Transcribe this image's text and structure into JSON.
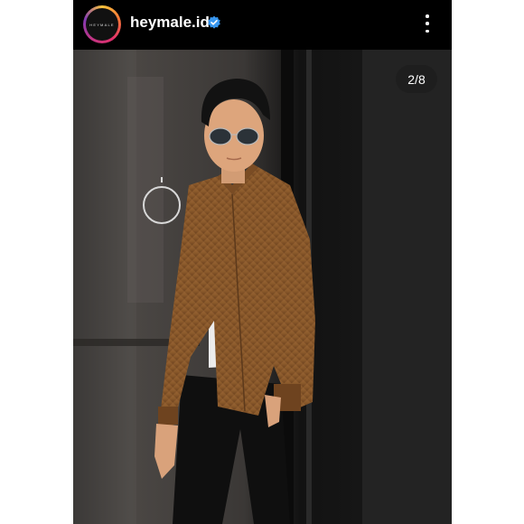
{
  "post": {
    "username": "heymale.id",
    "avatar_text": "HEYMALE",
    "verified_icon": "verified-badge-icon",
    "more_icon": "more-options-icon",
    "carousel_counter": "2/8",
    "colors": {
      "background": "#000000",
      "username": "#ffffff",
      "verified": "#3897f0",
      "jacket": "#8b5a2b"
    }
  }
}
